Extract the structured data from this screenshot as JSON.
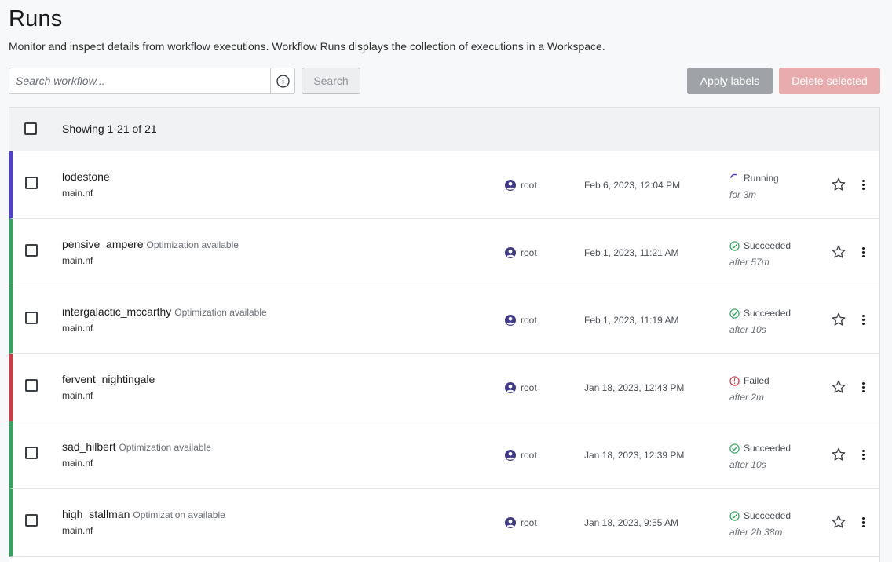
{
  "page": {
    "title": "Runs",
    "description": "Monitor and inspect details from workflow executions. Workflow Runs displays the collection of executions in a Workspace."
  },
  "toolbar": {
    "search_placeholder": "Search workflow...",
    "search_label": "Search",
    "apply_labels": "Apply labels",
    "delete_selected": "Delete selected"
  },
  "table": {
    "showing": "Showing 1-21 of 21",
    "rows": [
      {
        "name": "lodestone",
        "optimization": "",
        "file": "main.nf",
        "user": "root",
        "date": "Feb 6, 2023, 12:04 PM",
        "status": "Running",
        "duration": "for 3m",
        "status_color": "#4f3fd4",
        "status_icon": "spinner-icon"
      },
      {
        "name": "pensive_ampere",
        "optimization": "Optimization available",
        "file": "main.nf",
        "user": "root",
        "date": "Feb 1, 2023, 11:21 AM",
        "status": "Succeeded",
        "duration": "after 57m",
        "status_color": "#2ea65c",
        "status_icon": "check-circle-icon"
      },
      {
        "name": "intergalactic_mccarthy",
        "optimization": "Optimization available",
        "file": "main.nf",
        "user": "root",
        "date": "Feb 1, 2023, 11:19 AM",
        "status": "Succeeded",
        "duration": "after 10s",
        "status_color": "#2ea65c",
        "status_icon": "check-circle-icon"
      },
      {
        "name": "fervent_nightingale",
        "optimization": "",
        "file": "main.nf",
        "user": "root",
        "date": "Jan 18, 2023, 12:43 PM",
        "status": "Failed",
        "duration": "after 2m",
        "status_color": "#d9383f",
        "status_icon": "error-circle-icon"
      },
      {
        "name": "sad_hilbert",
        "optimization": "Optimization available",
        "file": "main.nf",
        "user": "root",
        "date": "Jan 18, 2023, 12:39 PM",
        "status": "Succeeded",
        "duration": "after 10s",
        "status_color": "#2ea65c",
        "status_icon": "check-circle-icon"
      },
      {
        "name": "high_stallman",
        "optimization": "Optimization available",
        "file": "main.nf",
        "user": "root",
        "date": "Jan 18, 2023, 9:55 AM",
        "status": "Succeeded",
        "duration": "after 2h 38m",
        "status_color": "#2ea65c",
        "status_icon": "check-circle-icon"
      }
    ]
  },
  "colors": {
    "user_icon": "#3f3a8a",
    "delete_button": "#e8acaf",
    "apply_button": "#9fa2a6"
  }
}
